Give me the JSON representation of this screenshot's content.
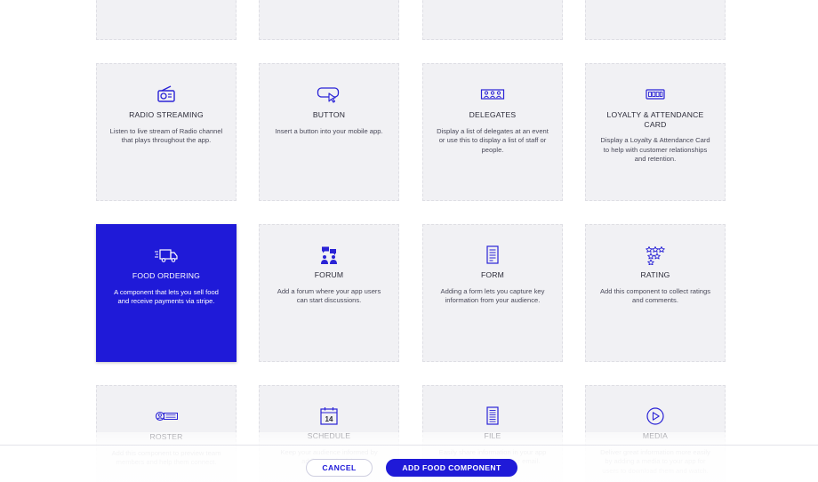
{
  "colors": {
    "accent": "#1f1ad8",
    "card_bg": "#f1f1f4",
    "text": "#2b2b38"
  },
  "components": [
    {
      "id": "radio",
      "icon": "radio-icon",
      "title": "RADIO STREAMING",
      "description": "Listen to live stream of Radio channel that plays throughout the app."
    },
    {
      "id": "button",
      "icon": "button-pointer-icon",
      "title": "BUTTON",
      "description": "Insert a button into your mobile app."
    },
    {
      "id": "delegates",
      "icon": "delegates-icon",
      "title": "DELEGATES",
      "description": "Display a list of delegates at an event or use this to display a list of staff or people."
    },
    {
      "id": "loyalty",
      "icon": "loyalty-card-icon",
      "title": "LOYALTY & ATTENDANCE CARD",
      "description": "Display a Loyalty & Attendance Card to help with customer relationships and retention."
    },
    {
      "id": "food",
      "icon": "delivery-truck-icon",
      "title": "FOOD ORDERING",
      "description": "A component that lets you sell food and receive payments via stripe."
    },
    {
      "id": "forum",
      "icon": "forum-icon",
      "title": "FORUM",
      "description": "Add a forum where your app users can start discussions."
    },
    {
      "id": "form",
      "icon": "form-icon",
      "title": "FORM",
      "description": "Adding a form lets you capture key information from your audience."
    },
    {
      "id": "rating",
      "icon": "rating-stars-icon",
      "title": "RATING",
      "description": "Add this component to collect ratings and comments."
    },
    {
      "id": "roster",
      "icon": "roster-icon",
      "title": "ROSTER",
      "description": "Add this component to preview team members and help them connect."
    },
    {
      "id": "schedule",
      "icon": "calendar-icon",
      "title": "SCHEDULE",
      "description": "Keep your audience informed by adding a schedule"
    },
    {
      "id": "file",
      "icon": "file-icon",
      "title": "FILE",
      "description": "Easily share information in your app by attaching a file to your email."
    },
    {
      "id": "media",
      "icon": "media-play-icon",
      "title": "MEDIA",
      "description": "Deliver great information more easily by adding a media to your app for users to download them and watch."
    }
  ],
  "schedule_icon_day": "14",
  "footer": {
    "cancel_label": "CANCEL",
    "add_label": "ADD FOOD COMPONENT"
  }
}
